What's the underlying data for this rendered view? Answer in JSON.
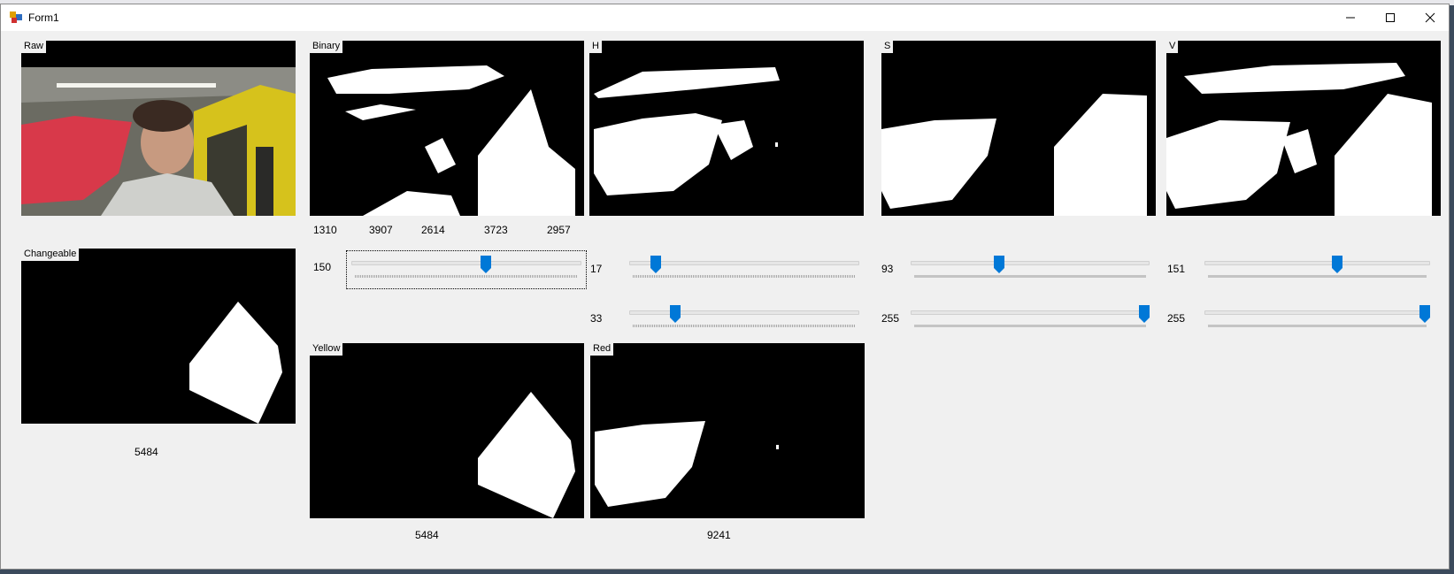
{
  "window": {
    "title": "Form1"
  },
  "panels": {
    "raw": {
      "label": "Raw"
    },
    "binary": {
      "label": "Binary"
    },
    "h": {
      "label": "H"
    },
    "s": {
      "label": "S"
    },
    "v": {
      "label": "V"
    },
    "changeable": {
      "label": "Changeable"
    },
    "yellow": {
      "label": "Yellow"
    },
    "red": {
      "label": "Red"
    }
  },
  "binary_counts": [
    "1310",
    "3907",
    "2614",
    "3723",
    "2957"
  ],
  "changeable_count": "5484",
  "yellow_count": "5484",
  "red_count": "9241",
  "trackbars": {
    "binary_threshold": {
      "label": "150",
      "value": 150,
      "max": 255
    },
    "h_low": {
      "label": "17",
      "value": 17,
      "max": 179
    },
    "h_high": {
      "label": "33",
      "value": 33,
      "max": 179
    },
    "s_low": {
      "label": "93",
      "value": 93,
      "max": 255
    },
    "s_high": {
      "label": "255",
      "value": 255,
      "max": 255
    },
    "v_low": {
      "label": "151",
      "value": 151,
      "max": 255
    },
    "v_high": {
      "label": "255",
      "value": 255,
      "max": 255
    }
  },
  "colors": {
    "accent": "#0078d7",
    "background": "#f0f0f0"
  }
}
